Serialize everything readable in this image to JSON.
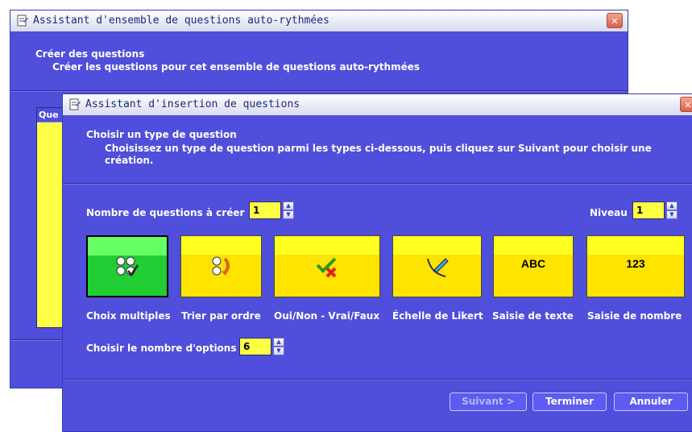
{
  "back_window": {
    "title": "Assistant d'ensemble de questions auto-rythmées",
    "header_title": "Créer des questions",
    "header_subtitle": "Créer les questions pour cet ensemble de questions auto-rythmées",
    "list_header_partial": "Que"
  },
  "dialog": {
    "title": "Assistant d'insertion de questions",
    "header_title": "Choisir un type de question",
    "header_subtitle": "Choisissez un type de question parmi les types ci-dessous, puis cliquez sur Suivant pour choisir une création.",
    "count_label": "Nombre de questions à créer",
    "count_value": "1",
    "level_label": "Niveau",
    "level_value": "1",
    "question_types": [
      {
        "label": "Choix multiples",
        "icon": "multiple-choice-icon",
        "selected": true
      },
      {
        "label": "Trier par ordre",
        "icon": "sort-order-icon",
        "selected": false
      },
      {
        "label": "Oui/Non - Vrai/Faux",
        "icon": "true-false-icon",
        "selected": false
      },
      {
        "label": "Échelle de Likert",
        "icon": "likert-scale-icon",
        "selected": false
      },
      {
        "label": "Saisie de texte",
        "icon": "text-entry-icon",
        "glyph": "ABC",
        "selected": false
      },
      {
        "label": "Saisie de nombre",
        "icon": "number-entry-icon",
        "glyph": "123",
        "selected": false
      }
    ],
    "options_label": "Choisir le nombre d'options",
    "options_value": "6",
    "buttons": {
      "next": "Suivant >",
      "finish": "Terminer",
      "cancel": "Annuler"
    }
  },
  "colors": {
    "panel": "#4F4FDB",
    "field": "#FFFF44",
    "tile": "#FFE400",
    "tile_selected": "#22CC33"
  }
}
